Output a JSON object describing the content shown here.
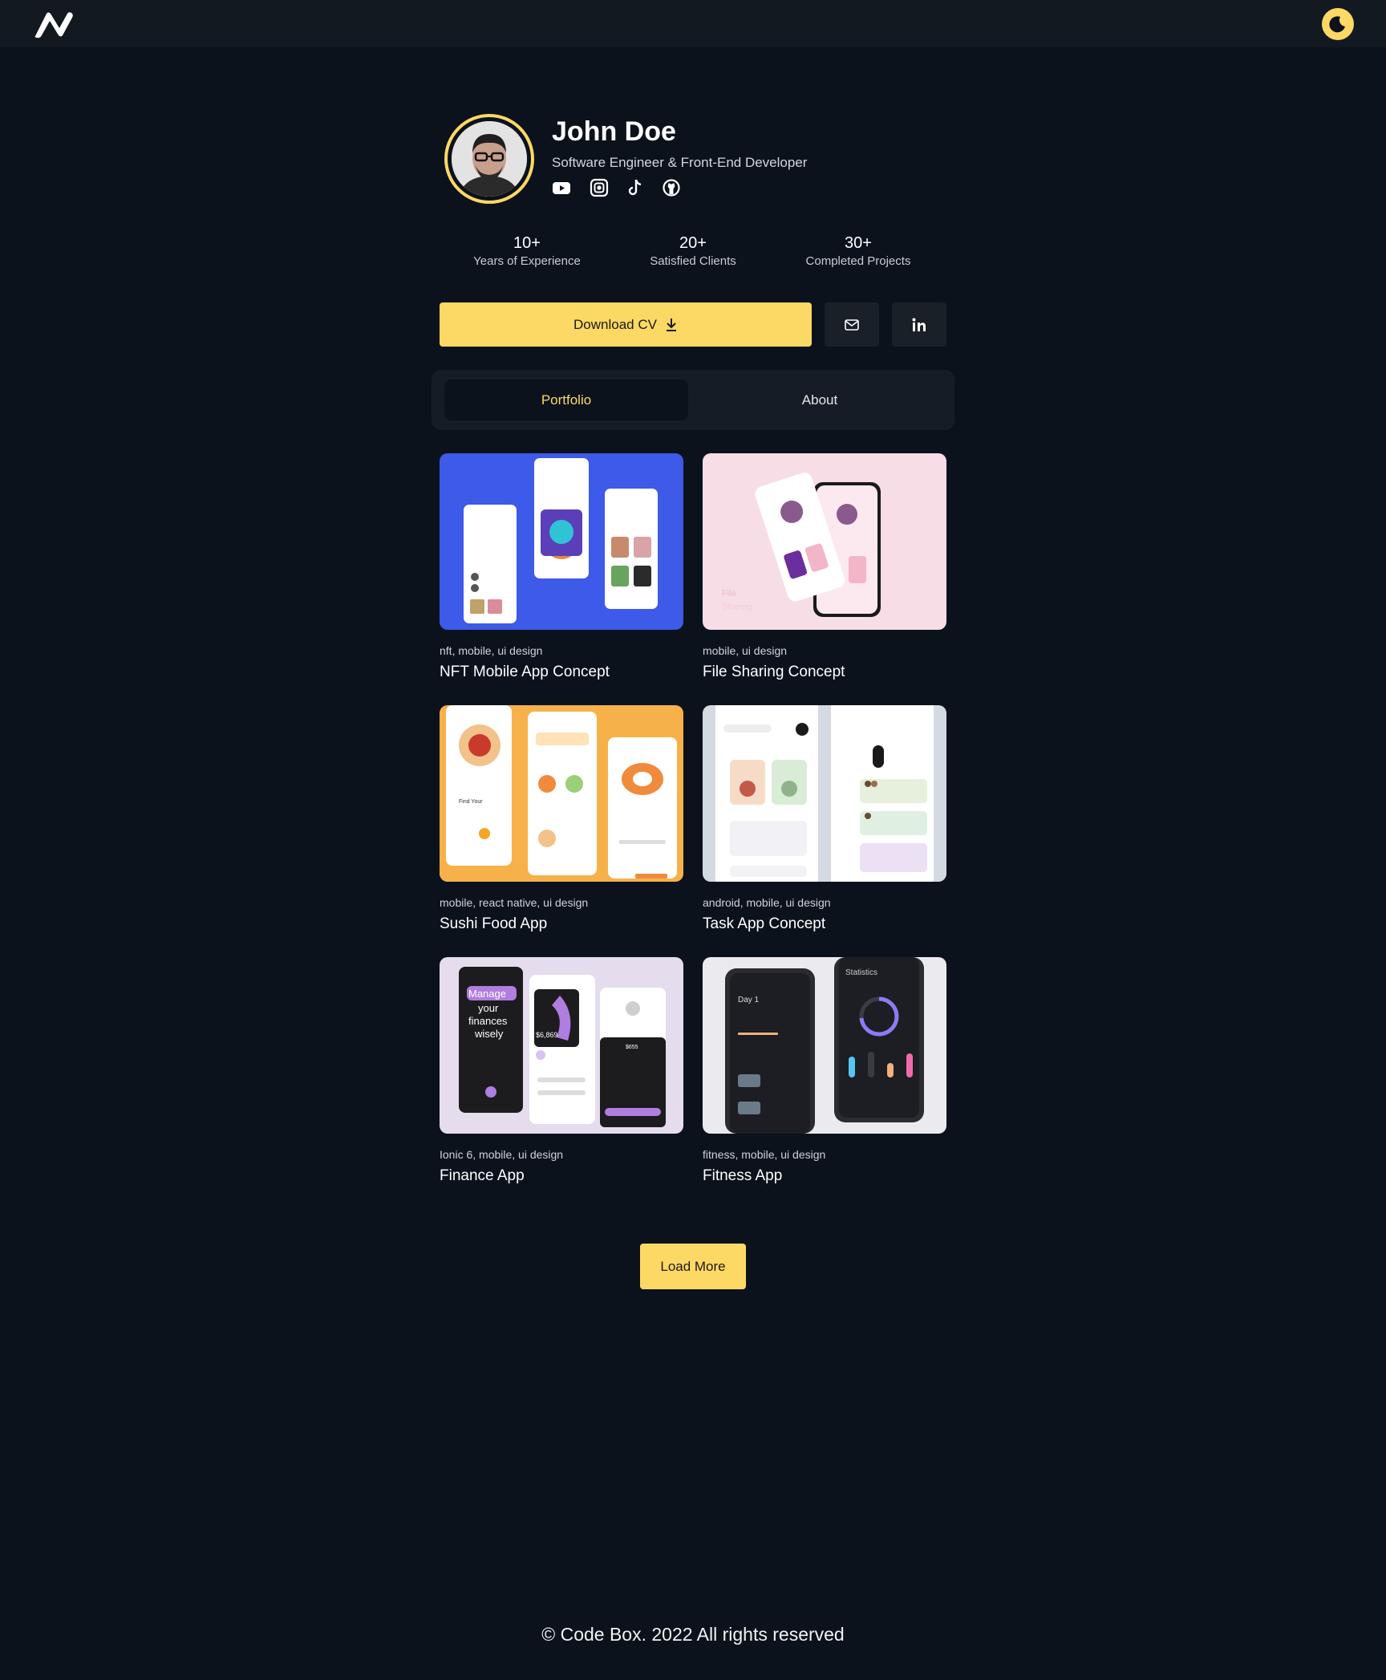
{
  "header": {
    "logo": "logo-mark",
    "theme_toggle_icon": "moon-icon"
  },
  "profile": {
    "name": "John Doe",
    "role": "Software Engineer & Front-End Developer",
    "socials": [
      "youtube-icon",
      "instagram-icon",
      "tiktok-icon",
      "github-icon"
    ]
  },
  "stats": [
    {
      "value": "10+",
      "label": "Years of Experience"
    },
    {
      "value": "20+",
      "label": "Satisfied Clients"
    },
    {
      "value": "30+",
      "label": "Completed Projects"
    }
  ],
  "actions": {
    "download_label": "Download CV",
    "mail_icon": "mail-icon",
    "linkedin_icon": "linkedin-icon"
  },
  "tabs": [
    {
      "label": "Portfolio",
      "active": true
    },
    {
      "label": "About",
      "active": false
    }
  ],
  "projects": [
    {
      "tags": "nft, mobile, ui design",
      "title": "NFT Mobile App Concept"
    },
    {
      "tags": "mobile, ui design",
      "title": "File Sharing Concept"
    },
    {
      "tags": "mobile, react native, ui design",
      "title": "Sushi Food App"
    },
    {
      "tags": "android, mobile, ui design",
      "title": "Task App Concept"
    },
    {
      "tags": "Ionic 6, mobile, ui design",
      "title": "Finance App"
    },
    {
      "tags": "fitness, mobile, ui design",
      "title": "Fitness App"
    }
  ],
  "load_more_label": "Load More",
  "footer": "© Code Box. 2022 All rights reserved",
  "colors": {
    "accent": "#fcd865",
    "background": "#0b121c",
    "topbar": "#121921"
  }
}
